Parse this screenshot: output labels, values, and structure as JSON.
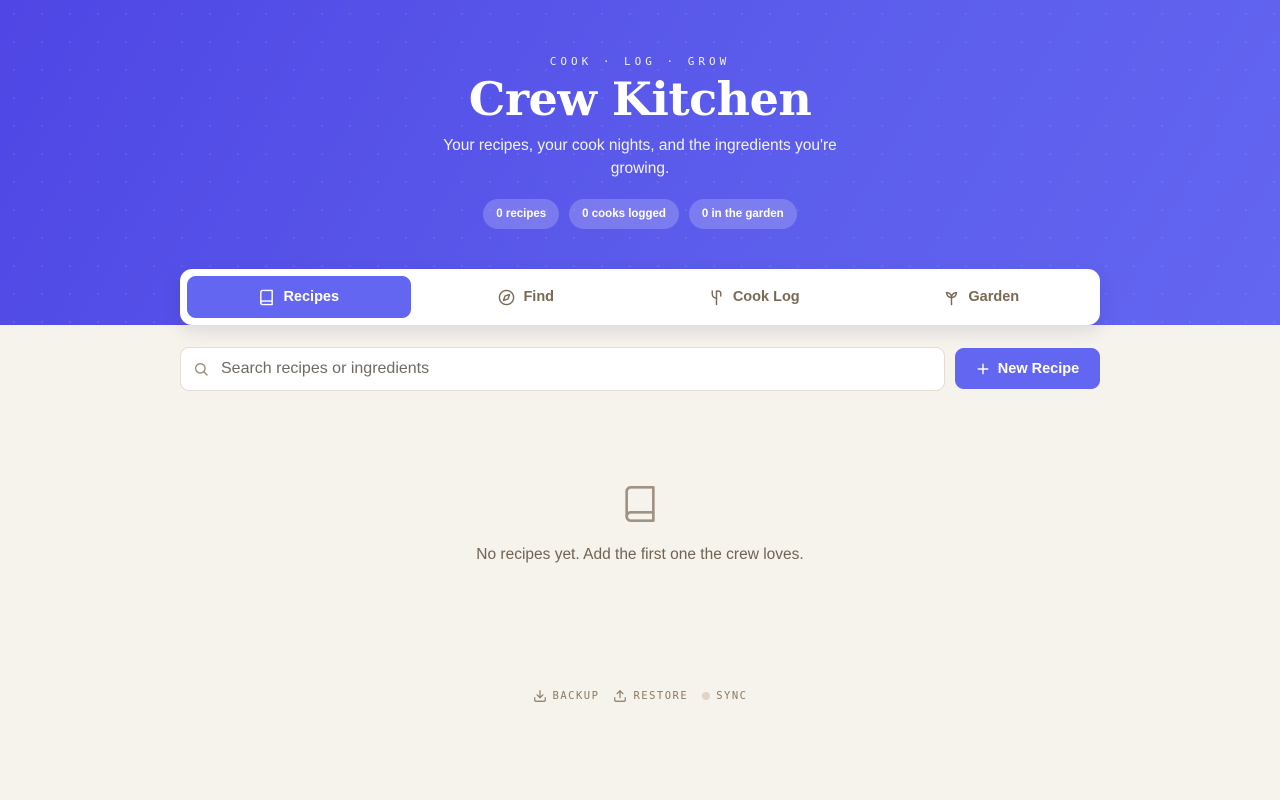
{
  "hero": {
    "eyebrow": "COOK · LOG · GROW",
    "title": "Crew Kitchen",
    "subtitle": "Your recipes, your cook nights, and the ingredients you're growing.",
    "stats": [
      {
        "label": "0 recipes"
      },
      {
        "label": "0 cooks logged"
      },
      {
        "label": "0 in the garden"
      }
    ]
  },
  "tabs": [
    {
      "label": "Recipes",
      "icon": "book-icon",
      "active": true
    },
    {
      "label": "Find",
      "icon": "compass-icon",
      "active": false
    },
    {
      "label": "Cook Log",
      "icon": "utensils-icon",
      "active": false
    },
    {
      "label": "Garden",
      "icon": "sprout-icon",
      "active": false
    }
  ],
  "search": {
    "placeholder": "Search recipes or ingredients",
    "value": ""
  },
  "new_recipe": {
    "label": "New Recipe",
    "icon": "plus-icon"
  },
  "empty_state": {
    "icon": "book-icon",
    "message": "No recipes yet. Add the first one the crew loves."
  },
  "footer": {
    "backup": "BACKUP",
    "restore": "RESTORE",
    "sync": "SYNC"
  },
  "colors": {
    "accent": "#6366f1",
    "hero_start": "#4f46e5",
    "background": "#f6f2ec",
    "muted_text": "#7a6a55",
    "sync_status_dot": "#dfd3c4"
  }
}
